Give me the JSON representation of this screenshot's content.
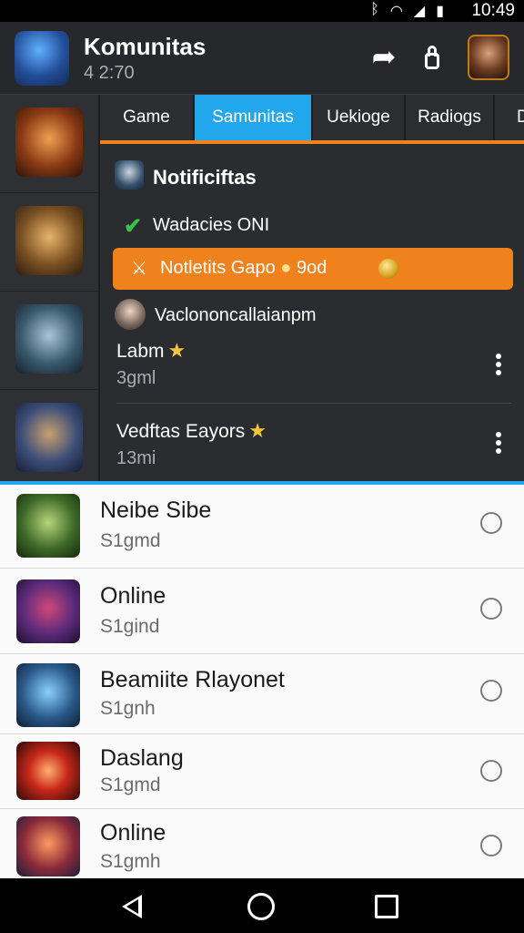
{
  "status_bar": {
    "time": "10:49",
    "icons": [
      "bluetooth-icon",
      "wifi-icon",
      "signal-icon",
      "battery-icon"
    ]
  },
  "header": {
    "title": "Komunitas",
    "subtitle": "4 2:70"
  },
  "tabs": [
    {
      "label": "Game",
      "active": false
    },
    {
      "label": "Samunitas",
      "active": true
    },
    {
      "label": "Uekioge",
      "active": false
    },
    {
      "label": "Radiogs",
      "active": false
    },
    {
      "label": "D",
      "active": false
    }
  ],
  "notifications": {
    "title": "Notificiftas",
    "check_item": "Wadacies ONI",
    "highlight": "Notletits Gapo",
    "highlight_value": "9od",
    "sub_name": "Vaclononcallaianpm",
    "rows": [
      {
        "title": "Labm",
        "subtitle": "3gml"
      },
      {
        "title": "Vedftas Eayors",
        "subtitle": "13mi"
      }
    ]
  },
  "list": [
    {
      "title": "Neibe Sibe",
      "subtitle": "S1gmd"
    },
    {
      "title": "Online",
      "subtitle": "S1gind"
    },
    {
      "title": "Beamiite Rlayonet",
      "subtitle": "S1gnh"
    },
    {
      "title": "Daslang",
      "subtitle": "S1gmd"
    },
    {
      "title": "Online",
      "subtitle": "S1gmh"
    }
  ],
  "colors": {
    "accent_orange": "#f0821e",
    "accent_blue": "#22a6ec",
    "dark_bg": "#2a2c30",
    "check_green": "#38c24a"
  }
}
